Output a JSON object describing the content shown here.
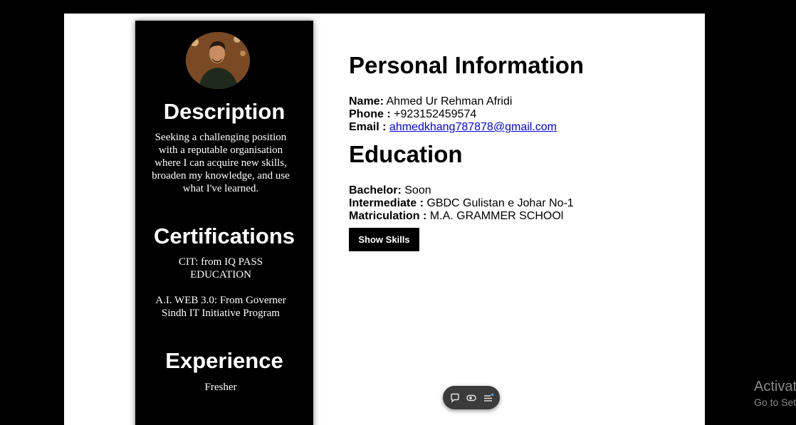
{
  "sidebar": {
    "description_heading": "Description",
    "description_text": "Seeking a challenging position with a reputable organisation where I can acquire new skills, broaden my knowledge, and use what I've learned.",
    "certifications_heading": "Certifications",
    "cert_1": "CIT: from IQ PASS EDUCATION",
    "cert_2": "A.I. WEB 3.0: From Governer Sindh IT Initiative Program",
    "experience_heading": "Experience",
    "experience_text": "Fresher"
  },
  "main": {
    "personal_heading": "Personal Information",
    "name_label": "Name:",
    "name_value": "Ahmed Ur Rehman Afridi",
    "phone_label": "Phone :",
    "phone_value": "+923152459574",
    "email_label": "Email :",
    "email_value": "ahmedkhang787878@gmail.com",
    "education_heading": "Education",
    "bachelor_label": "Bachelor:",
    "bachelor_value": "Soon",
    "intermediate_label": "Intermediate :",
    "intermediate_value": "GBDC Gulistan e Johar No-1",
    "matric_label": "Matriculation :",
    "matric_value": "M.A. GRAMMER SCHOOl",
    "show_skills_label": "Show Skills"
  },
  "overlay": {
    "activate_title": "Activat",
    "activate_sub": "Go to Set"
  },
  "icons": {
    "toolbar": [
      "chat-bubble-icon",
      "eye-toggle-icon",
      "menu-list-icon"
    ]
  },
  "colors": {
    "sidebar_bg": "#000000",
    "page_bg": "#ffffff",
    "link": "#0000ee",
    "button_bg": "#000000"
  }
}
